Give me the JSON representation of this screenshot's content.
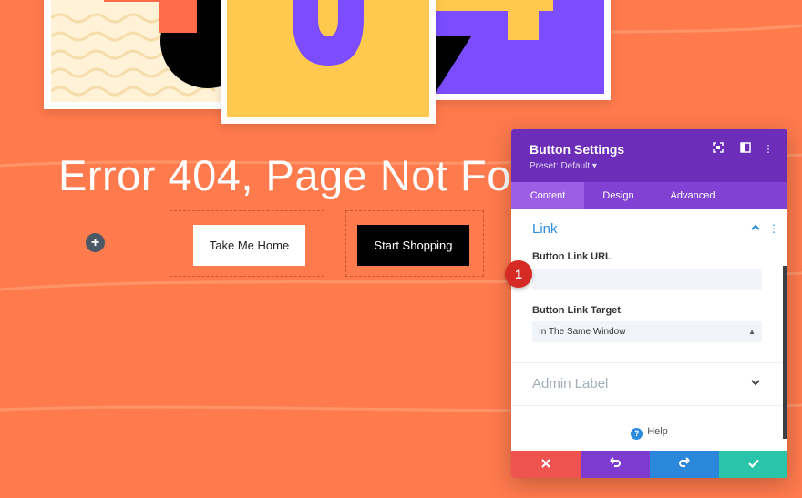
{
  "page": {
    "headline": "Error 404, Page Not Fo",
    "add_button": "+",
    "buttons": {
      "home": "Take Me Home",
      "shop": "Start Shopping"
    }
  },
  "artwork": {
    "digit_middle": "0"
  },
  "panel": {
    "title": "Button Settings",
    "preset": "Preset: Default ▾",
    "header_icons": [
      "fullscreen-icon",
      "split-view-icon",
      "more-icon"
    ],
    "tabs": [
      {
        "label": "Content",
        "active": true
      },
      {
        "label": "Design",
        "active": false
      },
      {
        "label": "Advanced",
        "active": false
      }
    ],
    "section_title": "Link",
    "link_url_label": "Button Link URL",
    "link_url_value": "",
    "link_target_label": "Button Link Target",
    "link_target_value": "In The Same Window",
    "admin_label": "Admin Label",
    "help": "Help",
    "footer": [
      "cancel-icon",
      "undo-icon",
      "redo-icon",
      "save-icon"
    ]
  },
  "badge": "1",
  "colors": {
    "background": "#ff7a4d",
    "panel_header": "#6c2eb9",
    "tabs": "#8142d4",
    "cancel": "#ef5350",
    "undo": "#7e3bd0",
    "redo": "#2b87da",
    "save": "#29c4a9"
  }
}
